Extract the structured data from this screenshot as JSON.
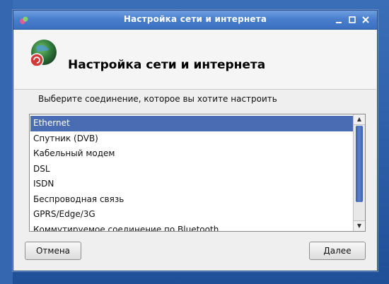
{
  "window": {
    "title": "Настройка сети и интернета",
    "controls": [
      "minimize-icon",
      "maximize-icon",
      "close-icon"
    ]
  },
  "header": {
    "title": "Настройка сети и интернета",
    "icon": "network-globe-icon"
  },
  "prompt": "Выберите соединение, которое вы хотите настроить",
  "connections": {
    "selected_index": 0,
    "items": [
      "Ethernet",
      "Спутник (DVB)",
      "Кабельный модем",
      "DSL",
      "ISDN",
      "Беспроводная связь",
      "GPRS/Edge/3G",
      "Коммутируемое соединение по Bluetooth"
    ]
  },
  "buttons": {
    "cancel": "Отмена",
    "next": "Далее"
  },
  "colors": {
    "selection": "#4a6cb3",
    "titlebar": "#4a7fce",
    "desktop": "#2d5fa8"
  }
}
